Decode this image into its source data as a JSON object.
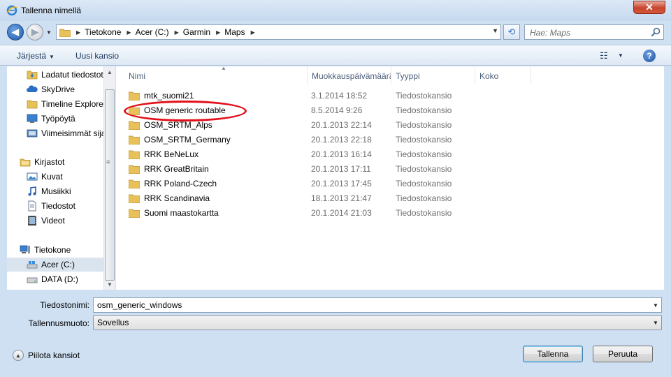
{
  "window": {
    "title": "Tallenna nimellä",
    "close_symbol": "✕"
  },
  "address": {
    "crumbs": [
      "Tietokone",
      "Acer (C:)",
      "Garmin",
      "Maps"
    ],
    "search_placeholder": "Hae: Maps"
  },
  "toolbar": {
    "organize_label": "Järjestä",
    "new_folder_label": "Uusi kansio"
  },
  "navpane": {
    "items": [
      {
        "label": "Ladatut tiedostot",
        "icon": "folder-icon"
      },
      {
        "label": "SkyDrive",
        "icon": "skydrive-icon"
      },
      {
        "label": "Timeline Explorer",
        "icon": "folder-icon"
      },
      {
        "label": "Työpöytä",
        "icon": "desktop-icon"
      },
      {
        "label": "Viimeisimmät sijainnit",
        "icon": "recent-places-icon"
      },
      {
        "label": "Kirjastot",
        "icon": "libraries-icon"
      },
      {
        "label": "Kuvat",
        "icon": "pictures-icon"
      },
      {
        "label": "Musiikki",
        "icon": "music-icon"
      },
      {
        "label": "Tiedostot",
        "icon": "documents-icon"
      },
      {
        "label": "Videot",
        "icon": "videos-icon"
      },
      {
        "label": "Tietokone",
        "icon": "computer-icon"
      },
      {
        "label": "Acer (C:)",
        "icon": "drive-icon",
        "selected": true
      },
      {
        "label": "DATA (D:)",
        "icon": "drive-icon"
      }
    ]
  },
  "columns": {
    "name": "Nimi",
    "modified": "Muokkauspäivämäärä",
    "type": "Tyyppi",
    "size": "Koko"
  },
  "files": [
    {
      "name": "mtk_suomi21",
      "modified": "3.1.2014 18:52",
      "type": "Tiedostokansio"
    },
    {
      "name": "OSM generic routable",
      "modified": "8.5.2014 9:26",
      "type": "Tiedostokansio"
    },
    {
      "name": "OSM_SRTM_Alps",
      "modified": "20.1.2013 22:14",
      "type": "Tiedostokansio"
    },
    {
      "name": "OSM_SRTM_Germany",
      "modified": "20.1.2013 22:18",
      "type": "Tiedostokansio"
    },
    {
      "name": "RRK BeNeLux",
      "modified": "20.1.2013 16:14",
      "type": "Tiedostokansio"
    },
    {
      "name": "RRK GreatBritain",
      "modified": "20.1.2013 17:11",
      "type": "Tiedostokansio"
    },
    {
      "name": "RRK Poland-Czech",
      "modified": "20.1.2013 17:45",
      "type": "Tiedostokansio"
    },
    {
      "name": "RRK Scandinavia",
      "modified": "18.1.2013 21:47",
      "type": "Tiedostokansio"
    },
    {
      "name": "Suomi maastokartta",
      "modified": "20.1.2014 21:03",
      "type": "Tiedostokansio"
    }
  ],
  "form": {
    "filename_label": "Tiedostonimi:",
    "filename_value": "osm_generic_windows",
    "filetype_label": "Tallennusmuoto:",
    "filetype_value": "Sovellus"
  },
  "footer": {
    "hide_folders_label": "Piilota kansiot",
    "save_label": "Tallenna",
    "cancel_label": "Peruuta"
  }
}
